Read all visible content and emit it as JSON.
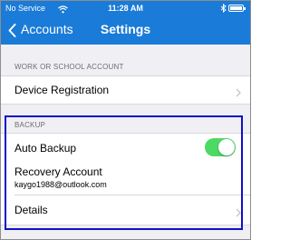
{
  "status_bar": {
    "carrier": "No Service",
    "time": "11:28 AM"
  },
  "nav": {
    "back_label": "Accounts",
    "title": "Settings"
  },
  "work_section": {
    "header": "WORK OR SCHOOL ACCOUNT",
    "device_registration_label": "Device Registration"
  },
  "backup_section": {
    "header": "BACKUP",
    "auto_backup_label": "Auto Backup",
    "auto_backup_enabled": true,
    "recovery_account_label": "Recovery Account",
    "recovery_account_email": "kaygo1988@outlook.com",
    "details_label": "Details"
  },
  "colors": {
    "nav_bar": "#1a7bd8",
    "toggle_on": "#4cd964",
    "highlight_border": "#1010c8",
    "background": "#efeff4"
  },
  "icons": {
    "wifi": "wifi-icon",
    "bluetooth": "bluetooth-icon",
    "battery": "battery-icon",
    "back": "chevron-left-icon",
    "disclosure": "chevron-right-icon"
  }
}
